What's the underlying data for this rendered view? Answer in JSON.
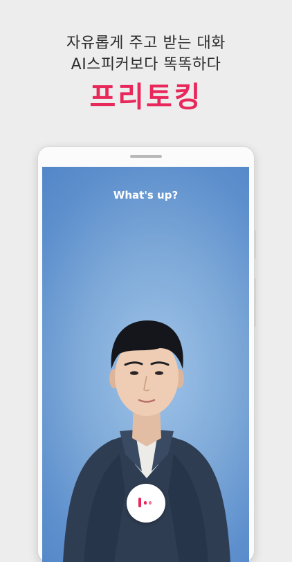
{
  "promo": {
    "line1": "자유롭게 주고 받는 대화",
    "line2": "AI스피커보다 똑똑하다",
    "brand": "프리토킹",
    "brand_color": "#e8275a"
  },
  "app_screen": {
    "prompt": "What's up?",
    "mic_icon": "voice-wave-icon"
  }
}
